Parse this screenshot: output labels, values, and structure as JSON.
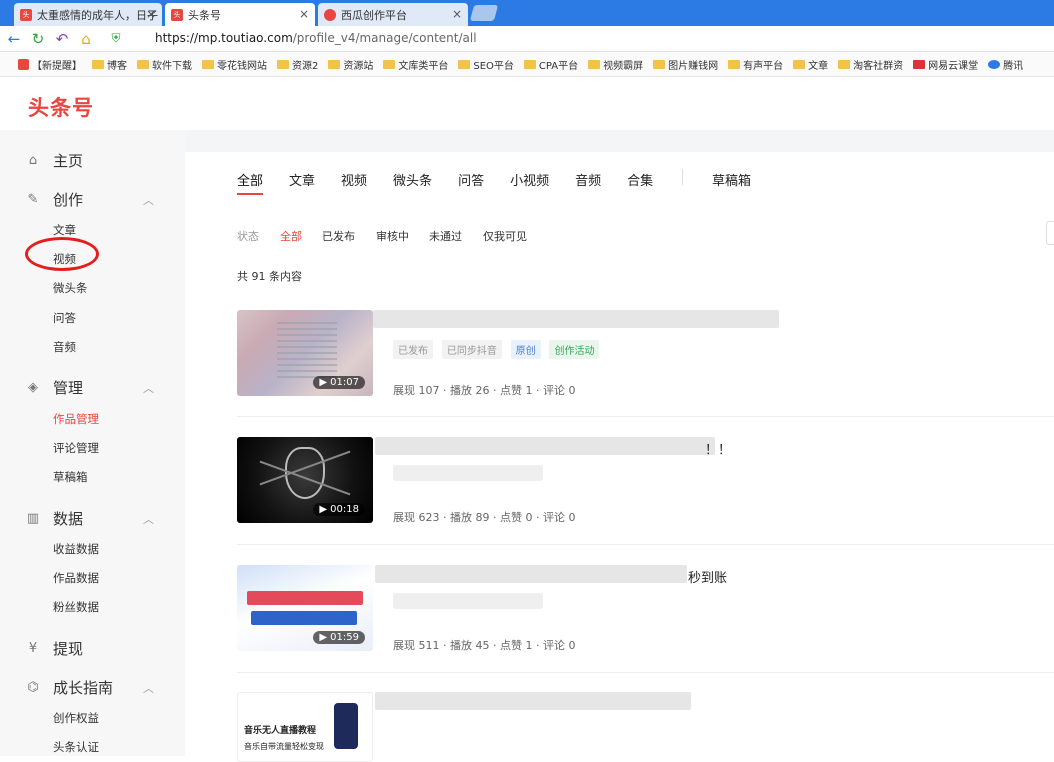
{
  "browser": {
    "tabs": [
      {
        "label": "太重感情的成年人，日子",
        "close": "×"
      },
      {
        "label": "头条号",
        "close": "×"
      },
      {
        "label": "西瓜创作平台",
        "close": "×"
      }
    ],
    "url_host": "https://mp.toutiao.com",
    "url_path": "/profile_v4/manage/content/all",
    "bookmarks": [
      "【新提醒】",
      "博客",
      "软件下载",
      "零花钱网站",
      "资源2",
      "资源站",
      "文库类平台",
      "SEO平台",
      "CPA平台",
      "视频霸屏",
      "图片赚钱网",
      "有声平台",
      "文章",
      "淘客社群资",
      "网易云课堂",
      "腾讯"
    ]
  },
  "header": {
    "logo": "头条号"
  },
  "sidebar": {
    "home": "主页",
    "create": {
      "label": "创作",
      "items": [
        "文章",
        "视频",
        "微头条",
        "问答",
        "音频"
      ]
    },
    "manage": {
      "label": "管理",
      "items": [
        "作品管理",
        "评论管理",
        "草稿箱"
      ]
    },
    "data": {
      "label": "数据",
      "items": [
        "收益数据",
        "作品数据",
        "粉丝数据"
      ]
    },
    "withdraw": "提现",
    "growth": {
      "label": "成长指南",
      "items": [
        "创作权益",
        "头条认证"
      ]
    }
  },
  "content": {
    "tabs": [
      "全部",
      "文章",
      "视频",
      "微头条",
      "问答",
      "小视频",
      "音频",
      "合集"
    ],
    "drafts_tab": "草稿箱",
    "status_label": "状态",
    "filters": [
      "全部",
      "已发布",
      "审核中",
      "未通过",
      "仅我可见"
    ],
    "total": "共 91 条内容",
    "items": [
      {
        "duration": "▶ 01:07",
        "tags": [
          "已发布",
          "已同步抖音",
          "原创",
          "创作活动"
        ],
        "stats": "展现 107 · 播放 26 · 点赞 1 · 评论 0",
        "title_tail": ""
      },
      {
        "duration": "▶ 00:18",
        "stats": "展现 623 · 播放 89 · 点赞 0 · 评论 0",
        "title_tail": "！！"
      },
      {
        "duration": "▶ 01:59",
        "stats": "展现 511 · 播放 45 · 点赞 1 · 评论 0",
        "title_tail": "秒到账"
      },
      {
        "thumb_title": "音乐无人直播教程",
        "thumb_subtitle": "音乐自带流量轻松变现"
      }
    ]
  },
  "colors": {
    "brand": "#e8463f",
    "browser_bar": "#2c7be5",
    "highlight_circle": "#e31e1e"
  }
}
